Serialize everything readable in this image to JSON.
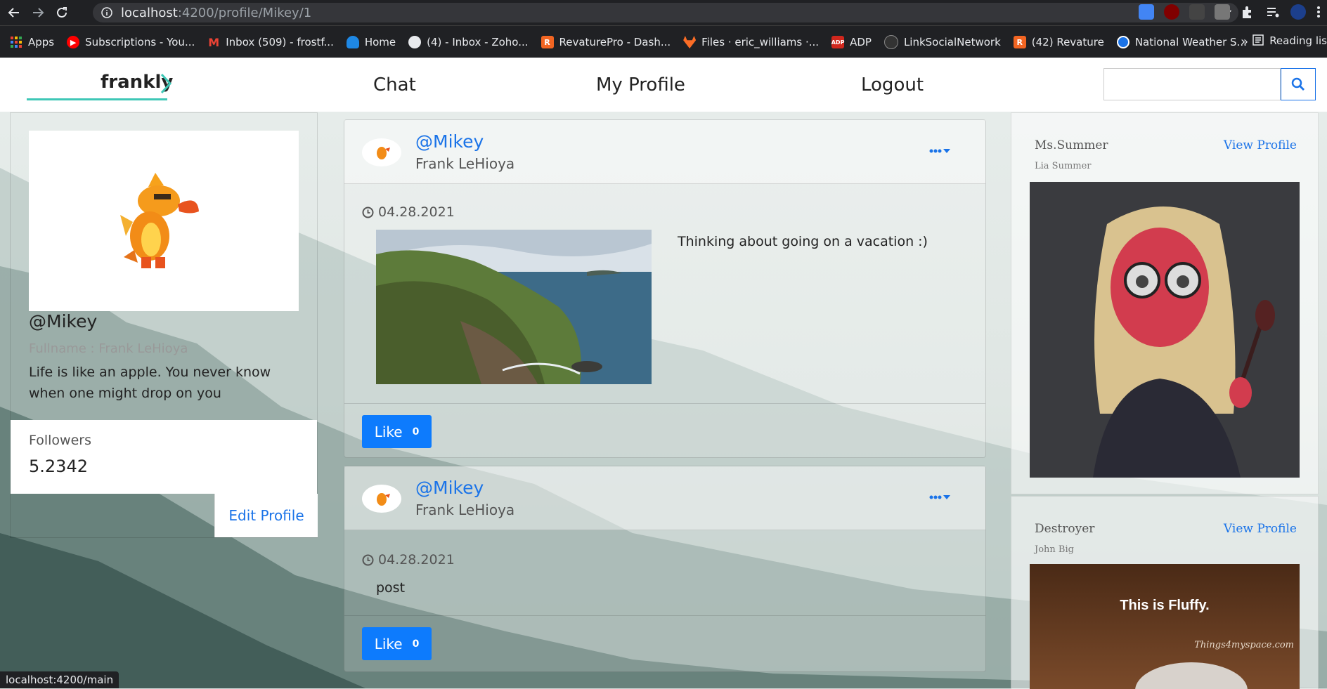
{
  "browser": {
    "url_host": "localhost",
    "url_path": ":4200/profile/Mikey/1",
    "bookmarks": [
      {
        "label": "Apps",
        "color": "#e94235"
      },
      {
        "label": "Subscriptions - You...",
        "color": "#ff0000"
      },
      {
        "label": "Inbox (509) - frostf...",
        "color": "#ea4335"
      },
      {
        "label": "Home",
        "color": "#1e88e5"
      },
      {
        "label": "(4) - Inbox - Zoho...",
        "color": "#9aa0a6"
      },
      {
        "label": "RevaturePro - Dash...",
        "color": "#f26522"
      },
      {
        "label": "Files · eric_williams ·...",
        "color": "#fc6d26"
      },
      {
        "label": "ADP",
        "color": "#d0271d"
      },
      {
        "label": "LinkSocialNetwork",
        "color": "#333333"
      },
      {
        "label": "(42) Revature",
        "color": "#f26522"
      },
      {
        "label": "National Weather S...",
        "color": "#1a73e8"
      }
    ],
    "more": "»",
    "reading_list": "Reading lis",
    "status_url": "localhost:4200/main"
  },
  "header": {
    "logo_text": "frankly",
    "nav": [
      "Chat",
      "My Profile",
      "Logout"
    ],
    "search_placeholder": ""
  },
  "profile": {
    "handle": "@Mikey",
    "fullname": "Fullname : Frank LeHioya",
    "bio": "Life is like an apple. You never know when one might drop on you",
    "followers_label": "Followers",
    "followers_value": "5.2342",
    "edit_label": "Edit Profile"
  },
  "posts": [
    {
      "handle": "@Mikey",
      "name": "Frank LeHioya",
      "date": "04.28.2021",
      "text": "Thinking about going on a vacation :)",
      "has_image": true,
      "like_label": "Like",
      "like_count": "0"
    },
    {
      "handle": "@Mikey",
      "name": "Frank LeHioya",
      "date": "04.28.2021",
      "text": "post",
      "has_image": false,
      "like_label": "Like",
      "like_count": "0"
    }
  ],
  "suggestions": [
    {
      "name": "Ms.Summer",
      "sub": "Lia Summer",
      "view": "View Profile"
    },
    {
      "name": "Destroyer",
      "sub": "John Big",
      "view": "View Profile",
      "image_text": "This is Fluffy.",
      "image_watermark": "Things4myspace.com"
    }
  ],
  "colors": {
    "accent": "#1a73e8",
    "like": "#0d7bfd",
    "logo_line": "#3ec7b6"
  }
}
